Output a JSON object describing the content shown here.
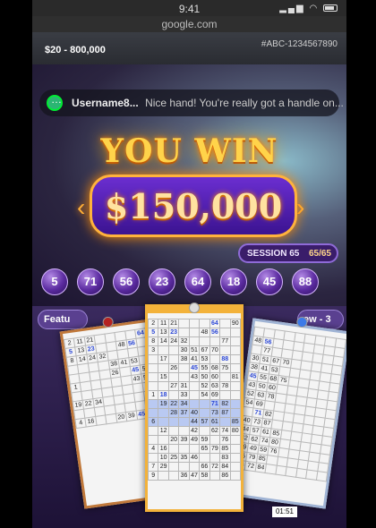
{
  "status": {
    "time": "9:41",
    "signal": "▂▄▆",
    "wifi": "◠"
  },
  "browser": {
    "url": "google.com"
  },
  "header": {
    "stake_range": "$20 - 800,000",
    "game_id": "#ABC-1234567890"
  },
  "chat": {
    "username": "Username8...",
    "message": "Nice hand! You're really got a handle on..."
  },
  "win": {
    "title": "YOU WIN",
    "amount": "$150,000"
  },
  "session": {
    "label": "SESSION 65",
    "count": "65/65"
  },
  "called_balls": [
    "5",
    "71",
    "56",
    "23",
    "64",
    "18",
    "45",
    "88"
  ],
  "buttons": {
    "left_pill": "Featu",
    "right_pill": "ew - 3"
  },
  "cards": {
    "left": [
      [
        "2",
        "11",
        "21",
        "",
        "",
        "",
        "",
        "64",
        ""
      ],
      [
        "5",
        "13",
        "23",
        "",
        "",
        "48",
        "56",
        "",
        ""
      ],
      [
        "8",
        "14",
        "24",
        "32",
        "",
        "",
        "",
        "",
        ""
      ],
      [
        "",
        "",
        "",
        "",
        "38",
        "41",
        "53",
        "",
        ""
      ],
      [
        "",
        "",
        "",
        "",
        "26",
        "",
        "45",
        "50",
        "",
        ""
      ],
      [
        "1",
        "",
        "",
        "",
        "",
        "",
        "43",
        "59",
        "",
        ""
      ],
      [
        "",
        "",
        "",
        "",
        "",
        "",
        "",
        "",
        ""
      ],
      [
        "19",
        "22",
        "34",
        "",
        "",
        "",
        "",
        "",
        ""
      ],
      [
        "",
        "",
        "",
        "",
        "",
        "",
        "",
        "",
        ""
      ],
      [
        "4",
        "16",
        "",
        "",
        "20",
        "39",
        "45",
        "",
        ""
      ]
    ],
    "center": [
      [
        "2",
        "11",
        "21",
        "",
        "",
        "",
        "64",
        "",
        "90"
      ],
      [
        "5",
        "13",
        "23",
        "",
        "",
        "48",
        "56",
        "",
        ""
      ],
      [
        "8",
        "14",
        "24",
        "32",
        "",
        "",
        "",
        "77",
        ""
      ],
      [
        "3",
        "",
        "",
        "30",
        "51",
        "67",
        "70",
        "",
        ""
      ],
      [
        "",
        "17",
        "",
        "38",
        "41",
        "53",
        "",
        "88",
        ""
      ],
      [
        "",
        "",
        "26",
        "",
        "45",
        "55",
        "68",
        "75",
        ""
      ],
      [
        "",
        "15",
        "",
        "",
        "43",
        "50",
        "60",
        "",
        "81"
      ],
      [
        "",
        "",
        "27",
        "31",
        "",
        "52",
        "63",
        "78",
        ""
      ],
      [
        "1",
        "18",
        "",
        "33",
        "",
        "54",
        "69",
        "",
        ""
      ],
      [
        "",
        "19",
        "22",
        "34",
        "",
        "",
        "71",
        "82",
        ""
      ],
      [
        "",
        "",
        "28",
        "37",
        "40",
        "",
        "73",
        "87",
        ""
      ],
      [
        "6",
        "",
        "",
        "",
        "44",
        "57",
        "61",
        "",
        "85"
      ],
      [
        "",
        "12",
        "",
        "",
        "42",
        "",
        "62",
        "74",
        "80"
      ],
      [
        "",
        "",
        "20",
        "39",
        "49",
        "59",
        "",
        "76",
        ""
      ],
      [
        "4",
        "16",
        "",
        "",
        "",
        "65",
        "79",
        "85",
        ""
      ],
      [
        "",
        "10",
        "25",
        "35",
        "46",
        "",
        "",
        "83",
        ""
      ],
      [
        "7",
        "29",
        "",
        "",
        "",
        "66",
        "72",
        "84",
        ""
      ],
      [
        "9",
        "",
        "",
        "36",
        "47",
        "58",
        "",
        "86",
        ""
      ]
    ],
    "right": [
      [
        "",
        "",
        "",
        "",
        "",
        "",
        "",
        "",
        ""
      ],
      [
        "48",
        "56",
        "",
        "",
        "",
        "",
        "",
        "",
        ""
      ],
      [
        "",
        "77",
        "",
        "",
        "",
        "",
        "",
        "",
        ""
      ],
      [
        "30",
        "51",
        "67",
        "70",
        "",
        "",
        "",
        "",
        ""
      ],
      [
        "38",
        "41",
        "53",
        "",
        "",
        "",
        "",
        "",
        ""
      ],
      [
        "45",
        "55",
        "68",
        "75",
        "",
        "",
        "",
        "",
        ""
      ],
      [
        "43",
        "50",
        "60",
        "",
        "",
        "",
        "",
        "",
        ""
      ],
      [
        "52",
        "63",
        "78",
        "",
        "",
        "",
        "",
        "",
        ""
      ],
      [
        "54",
        "69",
        "",
        "",
        "",
        "",
        "",
        "",
        ""
      ],
      [
        "",
        "71",
        "82",
        "",
        "",
        "",
        "",
        "",
        ""
      ],
      [
        "40",
        "73",
        "87",
        "",
        "",
        "",
        "",
        "",
        ""
      ],
      [
        "44",
        "57",
        "61",
        "85",
        "",
        "",
        "",
        "",
        ""
      ],
      [
        "42",
        "62",
        "74",
        "80",
        "",
        "",
        "",
        "",
        ""
      ],
      [
        "39",
        "49",
        "59",
        "76",
        "",
        "",
        "",
        "",
        ""
      ],
      [
        "65",
        "79",
        "85",
        "",
        "",
        "",
        "",
        "",
        ""
      ],
      [
        "66",
        "72",
        "84",
        "",
        "",
        "",
        "",
        "",
        ""
      ]
    ]
  },
  "marked": [
    "5",
    "71",
    "56",
    "23",
    "64",
    "18",
    "45",
    "88"
  ],
  "highlight_rows_center": [
    9,
    10,
    11
  ],
  "timer": "01:51",
  "colors": {
    "gold": "#ffd34a",
    "purple": "#5b2ba0",
    "mark": "#2a46d6"
  }
}
